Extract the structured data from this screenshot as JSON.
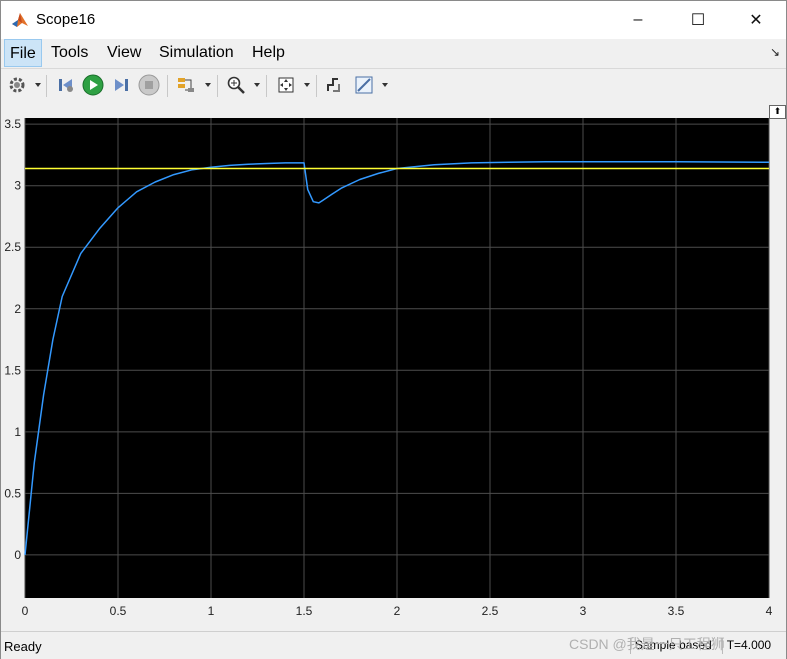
{
  "window": {
    "title": "Scope16",
    "controls": {
      "minimize": "–",
      "maximize": "☐",
      "close": "✕"
    }
  },
  "menu": {
    "items": [
      {
        "label": "File",
        "active": true
      },
      {
        "label": "Tools",
        "active": false
      },
      {
        "label": "View",
        "active": false
      },
      {
        "label": "Simulation",
        "active": false
      },
      {
        "label": "Help",
        "active": false
      }
    ],
    "pin_glyph": "↘"
  },
  "toolbar": {
    "icons": [
      "settings-icon",
      "step-back-icon",
      "run-icon",
      "step-forward-icon",
      "stop-icon",
      "signal-select-icon",
      "zoom-icon",
      "fit-view-icon",
      "signal-style-icon",
      "measure-icon"
    ]
  },
  "colors": {
    "plot_bg": "#000000",
    "grid": "#4d4d4d",
    "tick_text": "#ffffff",
    "series_response": "#3399ff",
    "series_reference": "#ffff33",
    "run_icon": "#2ea043"
  },
  "status": {
    "ready": "Ready",
    "mode": "Sample based",
    "time": "T=4.000"
  },
  "watermark": "CSDN @我是一只工程狮",
  "restore_glyph": "⬆",
  "chart_data": {
    "type": "line",
    "title": "",
    "xlabel": "",
    "ylabel": "",
    "xlim": [
      0,
      4
    ],
    "ylim": [
      -0.35,
      3.55
    ],
    "xticks": [
      0,
      0.5,
      1,
      1.5,
      2,
      2.5,
      3,
      3.5,
      4
    ],
    "yticks": [
      0,
      0.5,
      1,
      1.5,
      2,
      2.5,
      3,
      3.5
    ],
    "grid": true,
    "series": [
      {
        "color": "#3399ff",
        "x": [
          0,
          0.05,
          0.1,
          0.15,
          0.2,
          0.3,
          0.4,
          0.5,
          0.6,
          0.7,
          0.8,
          0.9,
          1.0,
          1.1,
          1.2,
          1.3,
          1.4,
          1.5,
          1.52,
          1.55,
          1.58,
          1.6,
          1.65,
          1.7,
          1.8,
          1.9,
          2.0,
          2.2,
          2.4,
          2.6,
          2.8,
          3.0,
          3.5,
          4.0
        ],
        "y": [
          0,
          0.75,
          1.3,
          1.75,
          2.1,
          2.45,
          2.65,
          2.82,
          2.95,
          3.03,
          3.09,
          3.13,
          3.15,
          3.165,
          3.175,
          3.18,
          3.185,
          3.185,
          2.97,
          2.87,
          2.86,
          2.88,
          2.93,
          2.98,
          3.05,
          3.1,
          3.14,
          3.17,
          3.185,
          3.19,
          3.195,
          3.195,
          3.195,
          3.19
        ]
      },
      {
        "color": "#ffff33",
        "x": [
          0,
          4
        ],
        "y": [
          3.14,
          3.14
        ]
      }
    ]
  }
}
